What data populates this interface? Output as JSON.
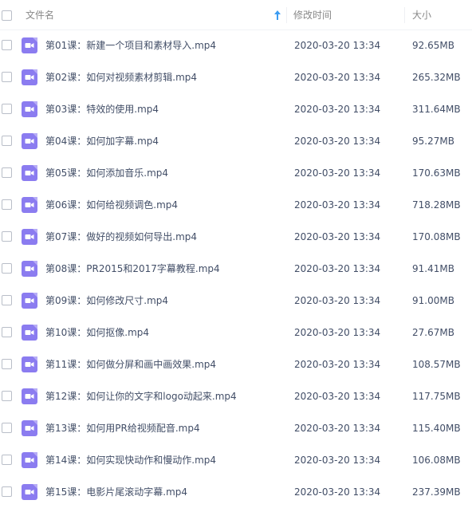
{
  "header": {
    "name_label": "文件名",
    "time_label": "修改时间",
    "size_label": "大小"
  },
  "files": [
    {
      "name": "第01课：新建一个项目和素材导入.mp4",
      "time": "2020-03-20 13:34",
      "size": "92.65MB"
    },
    {
      "name": "第02课：如何对视频素材剪辑.mp4",
      "time": "2020-03-20 13:34",
      "size": "265.32MB"
    },
    {
      "name": "第03课：特效的使用.mp4",
      "time": "2020-03-20 13:34",
      "size": "311.64MB"
    },
    {
      "name": "第04课：如何加字幕.mp4",
      "time": "2020-03-20 13:34",
      "size": "95.27MB"
    },
    {
      "name": "第05课：如何添加音乐.mp4",
      "time": "2020-03-20 13:34",
      "size": "170.63MB"
    },
    {
      "name": "第06课：如何给视频调色.mp4",
      "time": "2020-03-20 13:34",
      "size": "718.28MB"
    },
    {
      "name": "第07课：做好的视频如何导出.mp4",
      "time": "2020-03-20 13:34",
      "size": "170.08MB"
    },
    {
      "name": "第08课：PR2015和2017字幕教程.mp4",
      "time": "2020-03-20 13:34",
      "size": "91.41MB"
    },
    {
      "name": "第09课：如何修改尺寸.mp4",
      "time": "2020-03-20 13:34",
      "size": "91.00MB"
    },
    {
      "name": "第10课：如何抠像.mp4",
      "time": "2020-03-20 13:34",
      "size": "27.67MB"
    },
    {
      "name": "第11课：如何做分屏和画中画效果.mp4",
      "time": "2020-03-20 13:34",
      "size": "108.57MB"
    },
    {
      "name": "第12课：如何让你的文字和logo动起来.mp4",
      "time": "2020-03-20 13:34",
      "size": "117.75MB"
    },
    {
      "name": "第13课：如何用PR给视频配音.mp4",
      "time": "2020-03-20 13:34",
      "size": "115.40MB"
    },
    {
      "name": "第14课：如何实现快动作和慢动作.mp4",
      "time": "2020-03-20 13:34",
      "size": "106.08MB"
    },
    {
      "name": "第15课：电影片尾滚动字幕.mp4",
      "time": "2020-03-20 13:34",
      "size": "237.39MB"
    }
  ],
  "colors": {
    "video_icon": "#8b7cf0",
    "sort_arrow": "#3b9cf2"
  },
  "icons": {
    "file_type": "video-file-icon",
    "sort": "sort-ascending-icon"
  }
}
